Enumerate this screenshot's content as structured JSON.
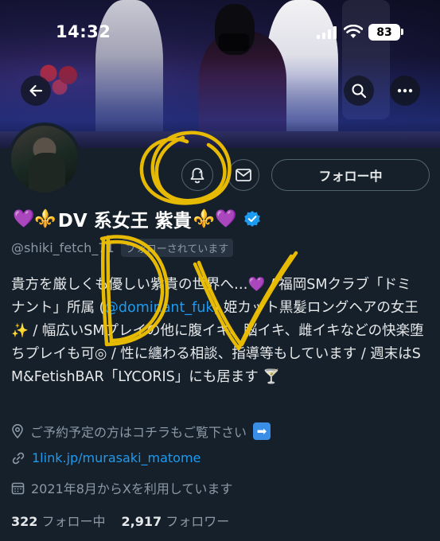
{
  "status_bar": {
    "time": "14:32",
    "battery": "83"
  },
  "colors": {
    "background": "#15202b",
    "accent": "#1d9bf0",
    "muted": "#8b98a5",
    "scribble": "#f2c200"
  },
  "header": {
    "back_icon": "arrow-left-icon",
    "search_icon": "search-icon",
    "more_icon": "more-horizontal-icon"
  },
  "actions": {
    "notify_icon": "bell-icon",
    "message_icon": "mail-icon",
    "follow_label": "フォロー中"
  },
  "profile": {
    "name_prefix_emoji": "💜⚜️",
    "name": "DV 系女王 紫貴",
    "name_suffix_emoji": "⚜️💜",
    "handle": "@shiki_fetch_71",
    "follows_you": "フォローされています",
    "bio_part1": "貴方を厳しくも優しい紫貴の世界へ…💜 / 福岡SMクラブ「ドミナント」所属 (",
    "bio_mention": "@dominant_fuk",
    "bio_part2": ") 姫カット黒髪ロングヘアの女王✨ / 幅広いSMプレイの他に腹イキ、脳イキ、雌イキなどの快楽堕ちプレイも可◎ / 性に纏わる相談、指導等もしています / 週末はSM&FetishBAR「LYCORIS」にも居ます 🍸",
    "reservation": "ご予約予定の方はコチラもご覧下さい",
    "link": "1link.jp/murasaki_matome",
    "joined": "2021年8月からXを利用しています",
    "following_count": "322",
    "following_label": "フォロー中",
    "followers_count": "2,917",
    "followers_label": "フォロワー"
  },
  "overlay_text": "DV"
}
